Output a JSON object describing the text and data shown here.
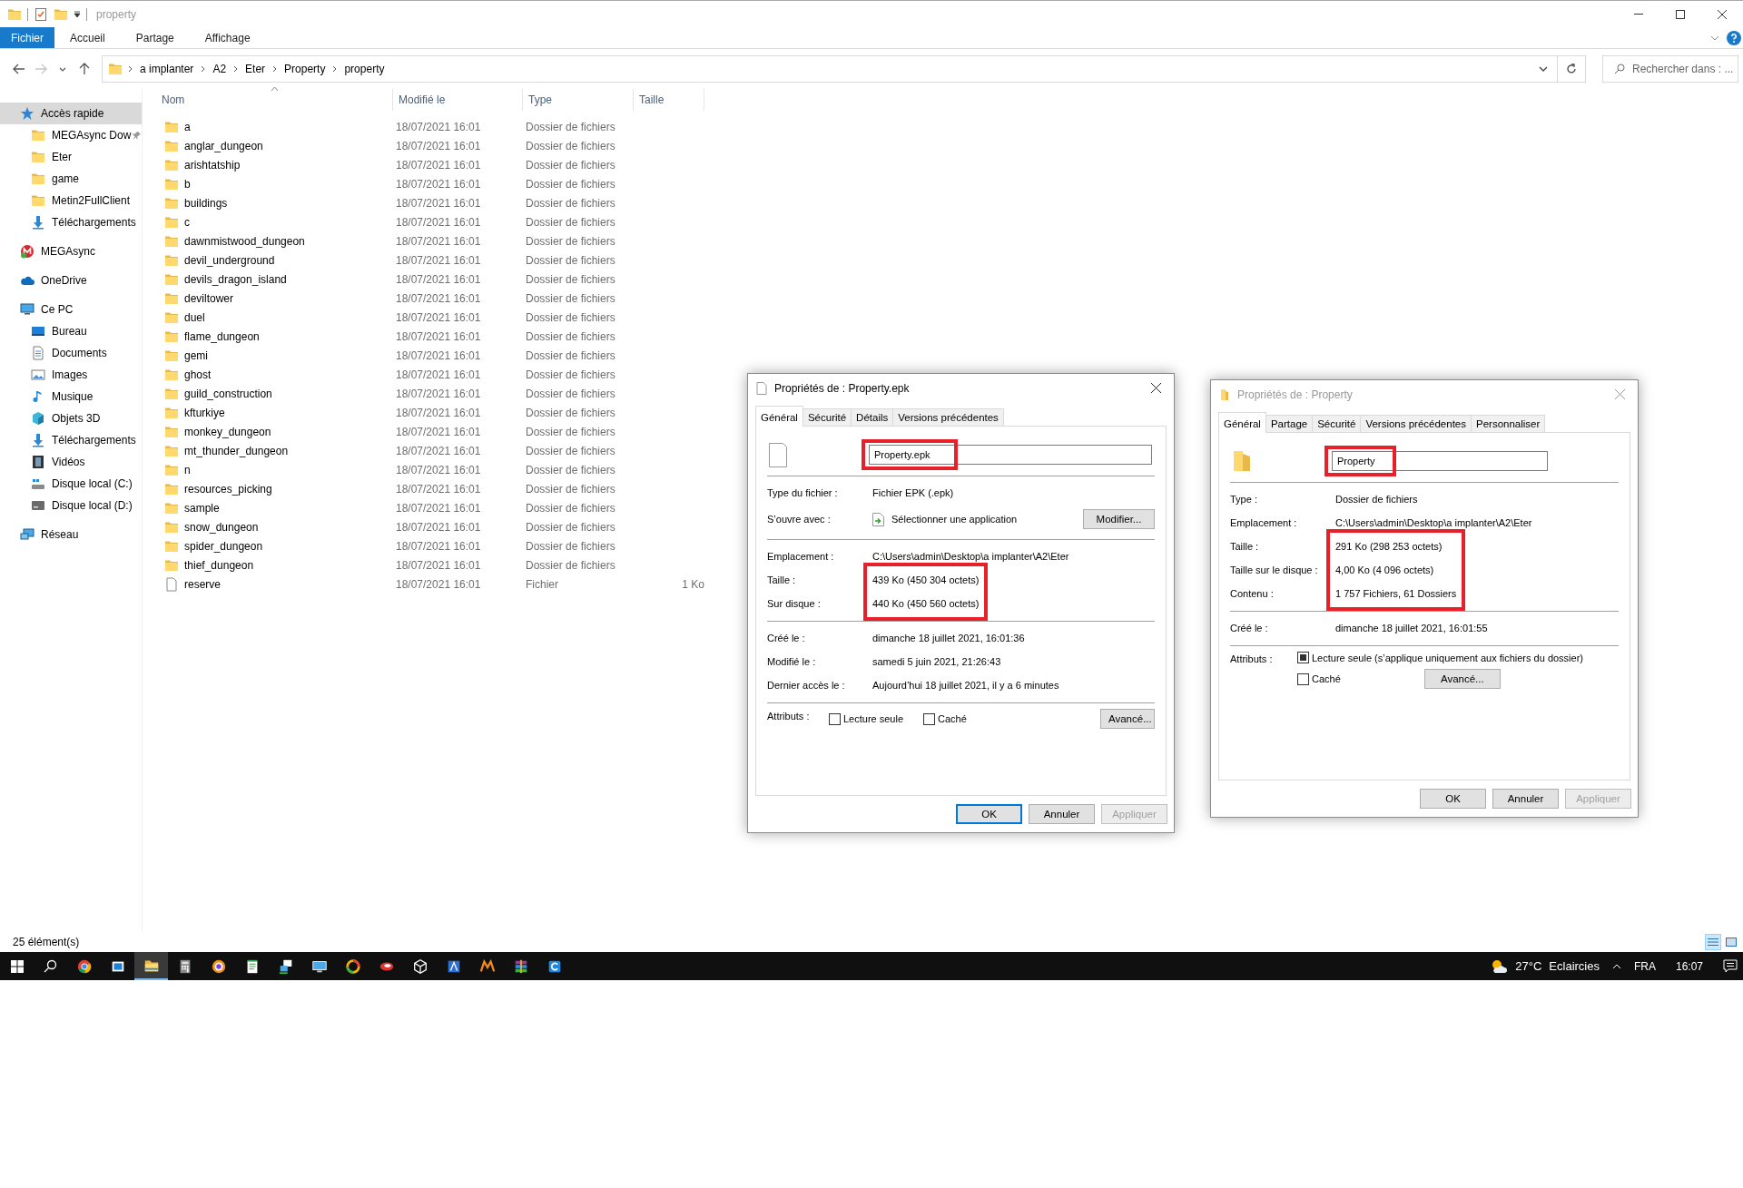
{
  "explorer": {
    "title": "property",
    "ribbon_tabs": [
      {
        "label": "Fichier",
        "selected": true
      },
      {
        "label": "Accueil",
        "selected": false
      },
      {
        "label": "Partage",
        "selected": false
      },
      {
        "label": "Affichage",
        "selected": false
      }
    ],
    "nav_buttons": [
      {
        "kind": "back",
        "disabled": false
      },
      {
        "kind": "forward",
        "disabled": true
      },
      {
        "kind": "recent",
        "disabled": false
      },
      {
        "kind": "up",
        "disabled": false
      }
    ],
    "breadcrumb": [
      "a implanter",
      "A2",
      "Eter",
      "Property",
      "property"
    ],
    "search": {
      "placeholder": "Rechercher dans : ..."
    },
    "sidebar": {
      "items": [
        {
          "label": "Accès rapide",
          "kind": "star",
          "selected": true,
          "pinned": false,
          "children": [
            {
              "label": "MEGAsync Dow",
              "kind": "folder",
              "selected": false,
              "pinned": true
            },
            {
              "label": "Eter",
              "kind": "folder",
              "selected": false,
              "pinned": false
            },
            {
              "label": "game",
              "kind": "folder",
              "selected": false,
              "pinned": false
            },
            {
              "label": "Metin2FullClient",
              "kind": "folder",
              "selected": false,
              "pinned": false
            },
            {
              "label": "Téléchargements",
              "kind": "download",
              "selected": false,
              "pinned": false
            }
          ]
        },
        {
          "label": "MEGAsync",
          "kind": "mega",
          "selected": false,
          "pinned": false
        },
        {
          "label": "OneDrive",
          "kind": "cloud",
          "selected": false,
          "pinned": false
        },
        {
          "label": "Ce PC",
          "kind": "pc",
          "selected": false,
          "pinned": false,
          "children": [
            {
              "label": "Bureau",
              "kind": "desktop",
              "selected": false,
              "pinned": false
            },
            {
              "label": "Documents",
              "kind": "document",
              "selected": false,
              "pinned": false
            },
            {
              "label": "Images",
              "kind": "picture",
              "selected": false,
              "pinned": false
            },
            {
              "label": "Musique",
              "kind": "music",
              "selected": false,
              "pinned": false
            },
            {
              "label": "Objets 3D",
              "kind": "cube",
              "selected": false,
              "pinned": false
            },
            {
              "label": "Téléchargements",
              "kind": "download",
              "selected": false,
              "pinned": false
            },
            {
              "label": "Vidéos",
              "kind": "film",
              "selected": false,
              "pinned": false
            },
            {
              "label": "Disque local (C:)",
              "kind": "system-drive",
              "selected": false,
              "pinned": false
            },
            {
              "label": "Disque local (D:)",
              "kind": "drive",
              "selected": false,
              "pinned": false
            }
          ]
        },
        {
          "label": "Réseau",
          "kind": "network",
          "selected": false,
          "pinned": false
        }
      ]
    },
    "columns": [
      {
        "label": "Nom",
        "sorted": true
      },
      {
        "label": "Modifié le",
        "sorted": false
      },
      {
        "label": "Type",
        "sorted": false
      },
      {
        "label": "Taille",
        "sorted": false
      }
    ],
    "rows": [
      {
        "name": "a",
        "modified": "18/07/2021 16:01",
        "type": "Dossier de fichiers",
        "kind": "folder"
      },
      {
        "name": "anglar_dungeon",
        "modified": "18/07/2021 16:01",
        "type": "Dossier de fichiers",
        "kind": "folder"
      },
      {
        "name": "arishtatship",
        "modified": "18/07/2021 16:01",
        "type": "Dossier de fichiers",
        "kind": "folder"
      },
      {
        "name": "b",
        "modified": "18/07/2021 16:01",
        "type": "Dossier de fichiers",
        "kind": "folder"
      },
      {
        "name": "buildings",
        "modified": "18/07/2021 16:01",
        "type": "Dossier de fichiers",
        "kind": "folder"
      },
      {
        "name": "c",
        "modified": "18/07/2021 16:01",
        "type": "Dossier de fichiers",
        "kind": "folder"
      },
      {
        "name": "dawnmistwood_dungeon",
        "modified": "18/07/2021 16:01",
        "type": "Dossier de fichiers",
        "kind": "folder"
      },
      {
        "name": "devil_underground",
        "modified": "18/07/2021 16:01",
        "type": "Dossier de fichiers",
        "kind": "folder"
      },
      {
        "name": "devils_dragon_island",
        "modified": "18/07/2021 16:01",
        "type": "Dossier de fichiers",
        "kind": "folder"
      },
      {
        "name": "deviltower",
        "modified": "18/07/2021 16:01",
        "type": "Dossier de fichiers",
        "kind": "folder"
      },
      {
        "name": "duel",
        "modified": "18/07/2021 16:01",
        "type": "Dossier de fichiers",
        "kind": "folder"
      },
      {
        "name": "flame_dungeon",
        "modified": "18/07/2021 16:01",
        "type": "Dossier de fichiers",
        "kind": "folder"
      },
      {
        "name": "gemi",
        "modified": "18/07/2021 16:01",
        "type": "Dossier de fichiers",
        "kind": "folder"
      },
      {
        "name": "ghost",
        "modified": "18/07/2021 16:01",
        "type": "Dossier de fichiers",
        "kind": "folder"
      },
      {
        "name": "guild_construction",
        "modified": "18/07/2021 16:01",
        "type": "Dossier de fichiers",
        "kind": "folder"
      },
      {
        "name": "kfturkiye",
        "modified": "18/07/2021 16:01",
        "type": "Dossier de fichiers",
        "kind": "folder"
      },
      {
        "name": "monkey_dungeon",
        "modified": "18/07/2021 16:01",
        "type": "Dossier de fichiers",
        "kind": "folder"
      },
      {
        "name": "mt_thunder_dungeon",
        "modified": "18/07/2021 16:01",
        "type": "Dossier de fichiers",
        "kind": "folder"
      },
      {
        "name": "n",
        "modified": "18/07/2021 16:01",
        "type": "Dossier de fichiers",
        "kind": "folder"
      },
      {
        "name": "resources_picking",
        "modified": "18/07/2021 16:01",
        "type": "Dossier de fichiers",
        "kind": "folder"
      },
      {
        "name": "sample",
        "modified": "18/07/2021 16:01",
        "type": "Dossier de fichiers",
        "kind": "folder"
      },
      {
        "name": "snow_dungeon",
        "modified": "18/07/2021 16:01",
        "type": "Dossier de fichiers",
        "kind": "folder"
      },
      {
        "name": "spider_dungeon",
        "modified": "18/07/2021 16:01",
        "type": "Dossier de fichiers",
        "kind": "folder"
      },
      {
        "name": "thief_dungeon",
        "modified": "18/07/2021 16:01",
        "type": "Dossier de fichiers",
        "kind": "folder"
      },
      {
        "name": "reserve",
        "modified": "18/07/2021 16:01",
        "type": "Fichier",
        "size": "1 Ko",
        "kind": "file"
      }
    ],
    "status_bar": {
      "text": "25 élément(s)",
      "views": [
        {
          "kind": "details",
          "selected": true
        },
        {
          "kind": "tiles",
          "selected": false
        }
      ]
    }
  },
  "dialogs": [
    {
      "title": "Propriétés de : Property.epk",
      "active": true,
      "kind": "file",
      "tabs": [
        {
          "label": "Général",
          "selected": true
        },
        {
          "label": "Sécurité",
          "selected": false
        },
        {
          "label": "Détails",
          "selected": false
        },
        {
          "label": "Versions précédentes",
          "selected": false
        }
      ],
      "name_field": {
        "value": "Property.epk",
        "highlighted": true
      },
      "sections": [
        {
          "kind": "info",
          "rows": [
            {
              "label": "Type du fichier :",
              "value": "Fichier EPK (.epk)",
              "highlighted": false
            },
            {
              "label": "S’ouvre avec :",
              "value": "Sélectionner une application",
              "button": "Modifier...",
              "highlighted": false
            }
          ]
        },
        {
          "kind": "info",
          "rows": [
            {
              "label": "Emplacement :",
              "value": "C:\\Users\\admin\\Desktop\\a implanter\\A2\\Eter",
              "highlighted": false
            },
            {
              "label": "Taille :",
              "value": "439 Ko (450 304 octets)",
              "highlighted": true
            },
            {
              "label": "Sur disque :",
              "value": "440 Ko (450 560 octets)",
              "highlighted": true
            }
          ]
        },
        {
          "kind": "info",
          "rows": [
            {
              "label": "Créé le :",
              "value": "dimanche 18 juillet 2021, 16:01:36",
              "highlighted": false
            },
            {
              "label": "Modifié le :",
              "value": "samedi 5 juin 2021, 21:26:43",
              "highlighted": false
            },
            {
              "label": "Dernier accès le :",
              "value": "Aujourd’hui 18 juillet 2021, il y a 6 minutes",
              "highlighted": false
            }
          ]
        },
        {
          "kind": "attributes-inline",
          "label": "Attributs :",
          "checkboxes": [
            {
              "label": "Lecture seule",
              "checked": false
            },
            {
              "label": "Caché",
              "checked": false
            }
          ],
          "button": "Avancé..."
        }
      ],
      "buttons": [
        {
          "label": "OK",
          "default": true,
          "disabled": false
        },
        {
          "label": "Annuler",
          "default": false,
          "disabled": false
        },
        {
          "label": "Appliquer",
          "default": false,
          "disabled": true
        }
      ]
    },
    {
      "title": "Propriétés de : Property",
      "active": false,
      "kind": "folder",
      "tabs": [
        {
          "label": "Général",
          "selected": true
        },
        {
          "label": "Partage",
          "selected": false
        },
        {
          "label": "Sécurité",
          "selected": false
        },
        {
          "label": "Versions précédentes",
          "selected": false
        },
        {
          "label": "Personnaliser",
          "selected": false
        }
      ],
      "name_field": {
        "value": "Property",
        "highlighted": true
      },
      "sections": [
        {
          "kind": "info",
          "rows": [
            {
              "label": "Type :",
              "value": "Dossier de fichiers",
              "highlighted": false
            },
            {
              "label": "Emplacement :",
              "value": "C:\\Users\\admin\\Desktop\\a implanter\\A2\\Eter",
              "highlighted": false
            },
            {
              "label": "Taille :",
              "value": "291 Ko (298 253 octets)",
              "highlighted": true
            },
            {
              "label": "Taille sur le disque :",
              "value": "4,00 Ko (4 096 octets)",
              "highlighted": true
            },
            {
              "label": "Contenu :",
              "value": "1 757 Fichiers, 61 Dossiers",
              "highlighted": true
            }
          ]
        },
        {
          "kind": "info",
          "rows": [
            {
              "label": "Créé le :",
              "value": "dimanche 18 juillet 2021, 16:01:55",
              "highlighted": false
            }
          ]
        },
        {
          "kind": "attributes-stacked",
          "label": "Attributs :",
          "checkboxes": [
            {
              "label": "Lecture seule (s’applique uniquement aux fichiers du dossier)",
              "checked": true,
              "indeterminate": true
            },
            {
              "label": "Caché",
              "checked": false
            }
          ],
          "button": "Avancé..."
        }
      ],
      "buttons": [
        {
          "label": "OK",
          "default": false,
          "disabled": false
        },
        {
          "label": "Annuler",
          "default": false,
          "disabled": false
        },
        {
          "label": "Appliquer",
          "default": false,
          "disabled": true
        }
      ]
    }
  ],
  "taskbar": {
    "apps": [
      {
        "kind": "chrome",
        "selected": false
      },
      {
        "kind": "taskview",
        "selected": false
      },
      {
        "kind": "explorer",
        "selected": true
      },
      {
        "kind": "calculator",
        "selected": false
      },
      {
        "kind": "orange-round",
        "selected": false
      },
      {
        "kind": "notepad",
        "selected": false
      },
      {
        "kind": "network",
        "selected": false
      },
      {
        "kind": "monitor",
        "selected": false
      },
      {
        "kind": "ring",
        "selected": false
      },
      {
        "kind": "red-round",
        "selected": false
      },
      {
        "kind": "cube",
        "selected": false
      },
      {
        "kind": "tile",
        "selected": false
      },
      {
        "kind": "m-logo",
        "selected": false
      },
      {
        "kind": "books",
        "selected": false
      },
      {
        "kind": "tile-c",
        "selected": false
      }
    ],
    "weather": {
      "temperature": "27°C",
      "condition": "Eclaircies"
    },
    "language": "FRA",
    "time": "16:07"
  }
}
